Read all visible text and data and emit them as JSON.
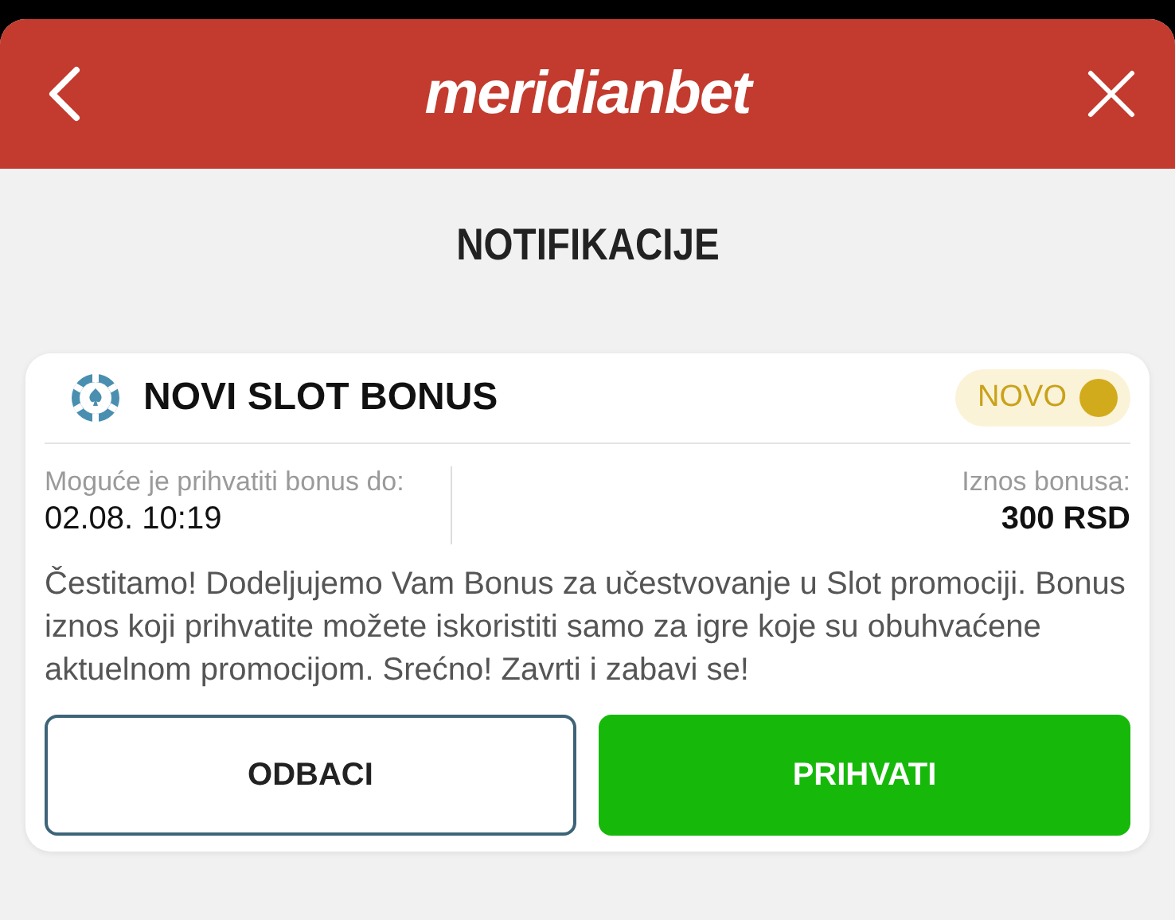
{
  "header": {
    "logo": "meridianbet"
  },
  "page_title": "NOTIFIKACIJE",
  "notifications": [
    {
      "title": "NOVI SLOT BONUS",
      "unread": true,
      "badge": "NOVO",
      "deadline_label": "Moguće je prihvatiti bonus do:",
      "deadline": "02.08. 10:19",
      "amount_label": "Iznos bonusa:",
      "amount": "300 RSD",
      "message": "Čestitamo! Dodeljujemo Vam Bonus za učestvovanje u Slot promociji. Bonus iznos koji prihvatite možete iskoristiti samo za igre koje su obuhvaćene aktuelnom promocijom. Srećno! Zavrti i zabavi se!",
      "buttons": [
        {
          "label": "ODBACI",
          "kind": "secondary"
        },
        {
          "label": "PRIHVATI",
          "kind": "primary"
        }
      ]
    }
  ]
}
